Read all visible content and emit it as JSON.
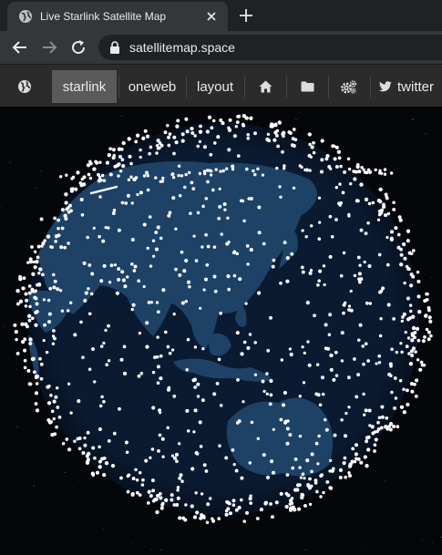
{
  "browser": {
    "tab_title": "Live Starlink Satellite Map",
    "url": "satellitemap.space",
    "icons": [
      "globe-icon",
      "close-icon",
      "plus-icon",
      "back-icon",
      "forward-icon",
      "reload-icon",
      "lock-icon"
    ]
  },
  "site_nav": {
    "items": [
      {
        "label": "starlink",
        "active": true
      },
      {
        "label": "oneweb",
        "active": false
      },
      {
        "label": "layout",
        "active": false
      }
    ],
    "icons": [
      "globe-icon",
      "home-icon",
      "folder-icon",
      "settings-icon",
      "twitter-icon"
    ],
    "twitter_label": "twitter"
  },
  "map": {
    "view": "Earth globe centered on Asia-Pacific with Starlink satellites",
    "colors": {
      "ocean": "#0a1b31",
      "land": "#1d4266",
      "satellite": "#ffffff",
      "background": "#04060a"
    }
  }
}
